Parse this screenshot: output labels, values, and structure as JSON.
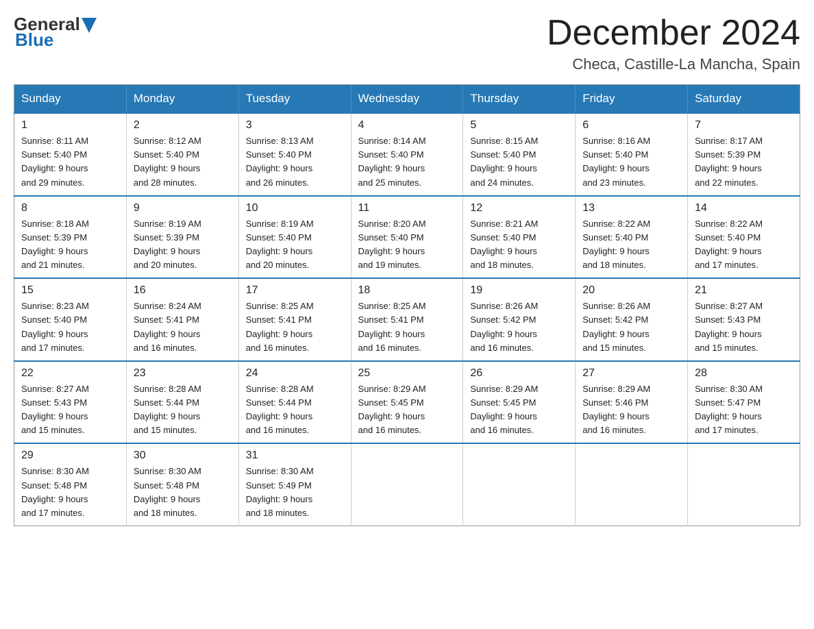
{
  "header": {
    "logo_general": "General",
    "logo_blue": "Blue",
    "title": "December 2024",
    "location": "Checa, Castille-La Mancha, Spain"
  },
  "columns": [
    "Sunday",
    "Monday",
    "Tuesday",
    "Wednesday",
    "Thursday",
    "Friday",
    "Saturday"
  ],
  "weeks": [
    [
      {
        "day": "1",
        "sunrise": "8:11 AM",
        "sunset": "5:40 PM",
        "daylight": "9 hours and 29 minutes."
      },
      {
        "day": "2",
        "sunrise": "8:12 AM",
        "sunset": "5:40 PM",
        "daylight": "9 hours and 28 minutes."
      },
      {
        "day": "3",
        "sunrise": "8:13 AM",
        "sunset": "5:40 PM",
        "daylight": "9 hours and 26 minutes."
      },
      {
        "day": "4",
        "sunrise": "8:14 AM",
        "sunset": "5:40 PM",
        "daylight": "9 hours and 25 minutes."
      },
      {
        "day": "5",
        "sunrise": "8:15 AM",
        "sunset": "5:40 PM",
        "daylight": "9 hours and 24 minutes."
      },
      {
        "day": "6",
        "sunrise": "8:16 AM",
        "sunset": "5:40 PM",
        "daylight": "9 hours and 23 minutes."
      },
      {
        "day": "7",
        "sunrise": "8:17 AM",
        "sunset": "5:39 PM",
        "daylight": "9 hours and 22 minutes."
      }
    ],
    [
      {
        "day": "8",
        "sunrise": "8:18 AM",
        "sunset": "5:39 PM",
        "daylight": "9 hours and 21 minutes."
      },
      {
        "day": "9",
        "sunrise": "8:19 AM",
        "sunset": "5:39 PM",
        "daylight": "9 hours and 20 minutes."
      },
      {
        "day": "10",
        "sunrise": "8:19 AM",
        "sunset": "5:40 PM",
        "daylight": "9 hours and 20 minutes."
      },
      {
        "day": "11",
        "sunrise": "8:20 AM",
        "sunset": "5:40 PM",
        "daylight": "9 hours and 19 minutes."
      },
      {
        "day": "12",
        "sunrise": "8:21 AM",
        "sunset": "5:40 PM",
        "daylight": "9 hours and 18 minutes."
      },
      {
        "day": "13",
        "sunrise": "8:22 AM",
        "sunset": "5:40 PM",
        "daylight": "9 hours and 18 minutes."
      },
      {
        "day": "14",
        "sunrise": "8:22 AM",
        "sunset": "5:40 PM",
        "daylight": "9 hours and 17 minutes."
      }
    ],
    [
      {
        "day": "15",
        "sunrise": "8:23 AM",
        "sunset": "5:40 PM",
        "daylight": "9 hours and 17 minutes."
      },
      {
        "day": "16",
        "sunrise": "8:24 AM",
        "sunset": "5:41 PM",
        "daylight": "9 hours and 16 minutes."
      },
      {
        "day": "17",
        "sunrise": "8:25 AM",
        "sunset": "5:41 PM",
        "daylight": "9 hours and 16 minutes."
      },
      {
        "day": "18",
        "sunrise": "8:25 AM",
        "sunset": "5:41 PM",
        "daylight": "9 hours and 16 minutes."
      },
      {
        "day": "19",
        "sunrise": "8:26 AM",
        "sunset": "5:42 PM",
        "daylight": "9 hours and 16 minutes."
      },
      {
        "day": "20",
        "sunrise": "8:26 AM",
        "sunset": "5:42 PM",
        "daylight": "9 hours and 15 minutes."
      },
      {
        "day": "21",
        "sunrise": "8:27 AM",
        "sunset": "5:43 PM",
        "daylight": "9 hours and 15 minutes."
      }
    ],
    [
      {
        "day": "22",
        "sunrise": "8:27 AM",
        "sunset": "5:43 PM",
        "daylight": "9 hours and 15 minutes."
      },
      {
        "day": "23",
        "sunrise": "8:28 AM",
        "sunset": "5:44 PM",
        "daylight": "9 hours and 15 minutes."
      },
      {
        "day": "24",
        "sunrise": "8:28 AM",
        "sunset": "5:44 PM",
        "daylight": "9 hours and 16 minutes."
      },
      {
        "day": "25",
        "sunrise": "8:29 AM",
        "sunset": "5:45 PM",
        "daylight": "9 hours and 16 minutes."
      },
      {
        "day": "26",
        "sunrise": "8:29 AM",
        "sunset": "5:45 PM",
        "daylight": "9 hours and 16 minutes."
      },
      {
        "day": "27",
        "sunrise": "8:29 AM",
        "sunset": "5:46 PM",
        "daylight": "9 hours and 16 minutes."
      },
      {
        "day": "28",
        "sunrise": "8:30 AM",
        "sunset": "5:47 PM",
        "daylight": "9 hours and 17 minutes."
      }
    ],
    [
      {
        "day": "29",
        "sunrise": "8:30 AM",
        "sunset": "5:48 PM",
        "daylight": "9 hours and 17 minutes."
      },
      {
        "day": "30",
        "sunrise": "8:30 AM",
        "sunset": "5:48 PM",
        "daylight": "9 hours and 18 minutes."
      },
      {
        "day": "31",
        "sunrise": "8:30 AM",
        "sunset": "5:49 PM",
        "daylight": "9 hours and 18 minutes."
      },
      null,
      null,
      null,
      null
    ]
  ],
  "labels": {
    "sunrise": "Sunrise:",
    "sunset": "Sunset:",
    "daylight": "Daylight:"
  }
}
